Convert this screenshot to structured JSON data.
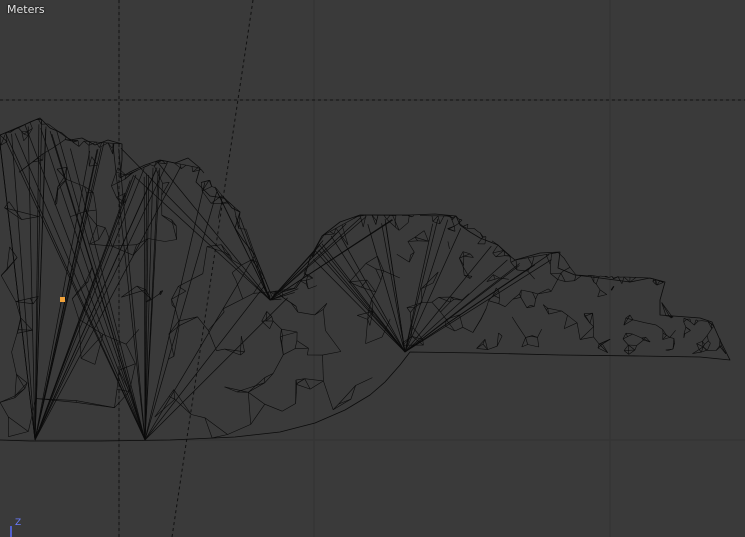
{
  "viewport": {
    "unit_label": "Meters",
    "axis_label": "Z"
  },
  "colors": {
    "background": "#3a3a3a",
    "grid_line": "#262626",
    "wire": "#0b0b0b",
    "selected_vertex": "#f2a33a",
    "axis_z": "#5a6cff"
  }
}
